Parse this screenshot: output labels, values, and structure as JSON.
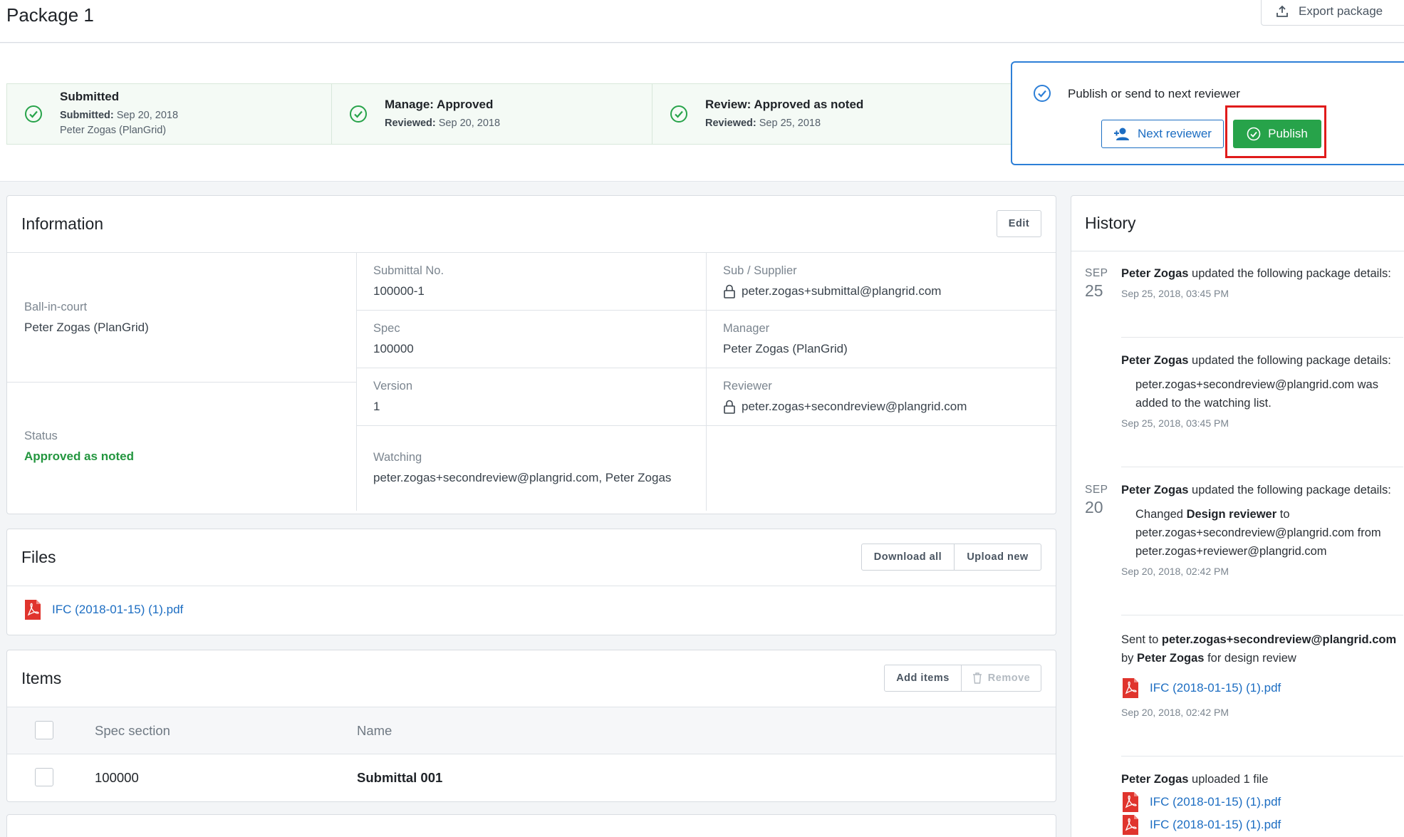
{
  "header": {
    "title": "Package 1",
    "export_label": "Export package"
  },
  "steps": [
    {
      "title": "Submitted",
      "sub_label": "Submitted:",
      "sub_date": "Sep 20, 2018",
      "person": "Peter Zogas (PlanGrid)"
    },
    {
      "title": "Manage: Approved",
      "sub_label": "Reviewed:",
      "sub_date": "Sep 20, 2018"
    },
    {
      "title": "Review: Approved as noted",
      "sub_label": "Reviewed:",
      "sub_date": "Sep 25, 2018"
    }
  ],
  "publish_panel": {
    "title": "Publish or send to next reviewer",
    "next_label": "Next reviewer",
    "publish_label": "Publish"
  },
  "information": {
    "title": "Information",
    "edit_label": "Edit",
    "ball_in_court_label": "Ball-in-court",
    "ball_in_court": "Peter Zogas (PlanGrid)",
    "status_label": "Status",
    "status": "Approved as noted",
    "submittal_no_label": "Submittal No.",
    "submittal_no": "100000-1",
    "sub_supplier_label": "Sub / Supplier",
    "sub_supplier": "peter.zogas+submittal@plangrid.com",
    "spec_label": "Spec",
    "spec": "100000",
    "manager_label": "Manager",
    "manager": "Peter Zogas (PlanGrid)",
    "version_label": "Version",
    "version": "1",
    "reviewer_label": "Reviewer",
    "reviewer": "peter.zogas+secondreview@plangrid.com",
    "watching_label": "Watching",
    "watching": "peter.zogas+secondreview@plangrid.com, Peter Zogas"
  },
  "files": {
    "title": "Files",
    "download_label": "Download all",
    "upload_label": "Upload new",
    "file_name": "IFC (2018-01-15) (1).pdf"
  },
  "items": {
    "title": "Items",
    "add_label": "Add items",
    "remove_label": "Remove",
    "col_spec": "Spec section",
    "col_name": "Name",
    "rows": [
      {
        "spec": "100000",
        "name": "Submittal 001"
      }
    ]
  },
  "history": {
    "title": "History",
    "badge1": {
      "month": "SEP",
      "day": "25"
    },
    "badge2": {
      "month": "SEP",
      "day": "20"
    },
    "e1": {
      "who": "Peter Zogas",
      "text": "updated the following package details:",
      "ts": "Sep 25, 2018, 03:45 PM"
    },
    "e2": {
      "who": "Peter Zogas",
      "text": "updated the following package details:",
      "detail": "peter.zogas+secondreview@plangrid.com was added to the watching list.",
      "ts": "Sep 25, 2018, 03:45 PM"
    },
    "e3": {
      "who": "Peter Zogas",
      "text": "updated the following package details:",
      "changed": "Changed",
      "field": "Design reviewer",
      "to": "to",
      "to_value": "peter.zogas+secondreview@plangrid.com",
      "from": "from peter.zogas+reviewer@plangrid.com",
      "ts": "Sep 20, 2018, 02:42 PM"
    },
    "e4": {
      "sent_to": "Sent to",
      "email": "peter.zogas+secondreview@plangrid.com",
      "by": "by",
      "who": "Peter Zogas",
      "purpose": "for design review",
      "file": "IFC (2018-01-15) (1).pdf",
      "ts": "Sep 20, 2018, 02:42 PM"
    },
    "e5": {
      "who": "Peter Zogas",
      "text": "uploaded 1 file",
      "file1": "IFC (2018-01-15) (1).pdf",
      "file2": "IFC (2018-01-15) (1).pdf"
    }
  },
  "colors": {
    "accent": "#1c6dc2",
    "success": "#27a34a",
    "highlight": "#e01b1b"
  }
}
